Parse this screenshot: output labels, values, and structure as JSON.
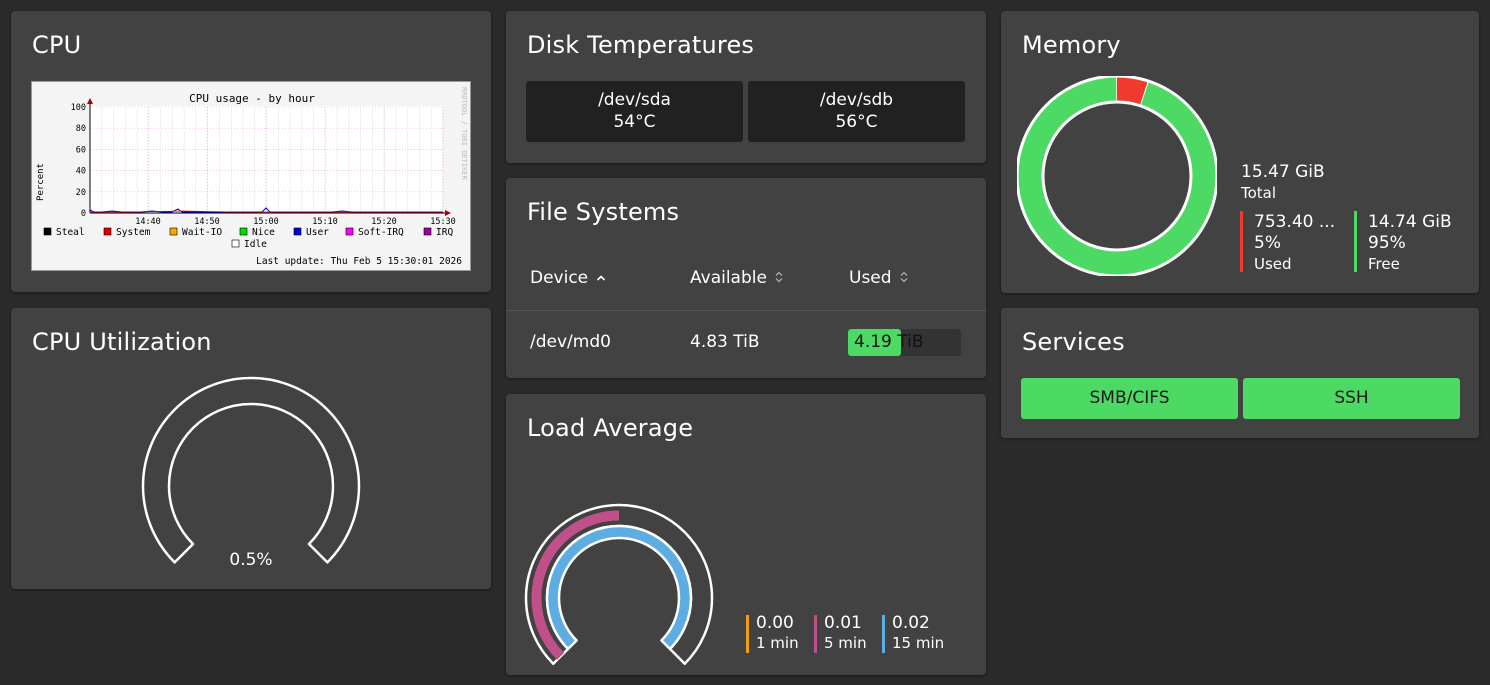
{
  "cpu": {
    "title": "CPU",
    "graph": {
      "title": "CPU usage - by hour",
      "ylabel": "Percent",
      "side_label": "RRDTOOL / TOBI OETIKER",
      "y_ticks": [
        "100",
        "80",
        "60",
        "40",
        "20",
        "0"
      ],
      "x_ticks": [
        "14:40",
        "14:50",
        "15:00",
        "15:10",
        "15:20",
        "15:30"
      ],
      "legend": [
        {
          "label": "Steal",
          "color": "#000000"
        },
        {
          "label": "System",
          "color": "#e00000"
        },
        {
          "label": "Wait-IO",
          "color": "#ffa500"
        },
        {
          "label": "Nice",
          "color": "#00e000"
        },
        {
          "label": "User",
          "color": "#0000e0"
        },
        {
          "label": "Soft-IRQ",
          "color": "#ff00ff"
        },
        {
          "label": "IRQ",
          "color": "#a000a0"
        },
        {
          "label": "Idle",
          "color": "#ffffff"
        }
      ],
      "last_update": "Last update: Thu Feb  5 15:30:01 2026"
    }
  },
  "cpu_util": {
    "title": "CPU Utilization",
    "value_label": "0.5%",
    "value": 0.005
  },
  "disk_temps": {
    "title": "Disk Temperatures",
    "disks": [
      {
        "device": "/dev/sda",
        "temp": "54°C"
      },
      {
        "device": "/dev/sdb",
        "temp": "56°C"
      }
    ]
  },
  "filesystems": {
    "title": "File Systems",
    "columns": {
      "device": "Device",
      "available": "Available",
      "used": "Used"
    },
    "sort_icons": {
      "device": "chevron-up-icon",
      "available": "sort-icon",
      "used": "sort-icon"
    },
    "rows": [
      {
        "device": "/dev/md0",
        "available": "4.83 TiB",
        "used": "4.19 TiB",
        "used_fraction": 0.47
      }
    ]
  },
  "load": {
    "title": "Load Average",
    "items": [
      {
        "value": "0.00",
        "label": "1 min",
        "color": "#f39c12",
        "fraction": 0.0
      },
      {
        "value": "0.01",
        "label": "5 min",
        "color": "#c0508a",
        "fraction": 0.01
      },
      {
        "value": "0.02",
        "label": "15 min",
        "color": "#5dade2",
        "fraction": 0.02
      }
    ]
  },
  "memory": {
    "title": "Memory",
    "total_value": "15.47 GiB",
    "total_label": "Total",
    "used": {
      "value": "753.40 ...",
      "percent": "5%",
      "label": "Used",
      "color": "#f03a2e"
    },
    "free": {
      "value": "14.74 GiB",
      "percent": "95%",
      "label": "Free",
      "color": "#4cd964"
    },
    "used_fraction": 0.05
  },
  "services": {
    "title": "Services",
    "items": [
      "SMB/CIFS",
      "SSH"
    ],
    "color": "#4cd964"
  }
}
